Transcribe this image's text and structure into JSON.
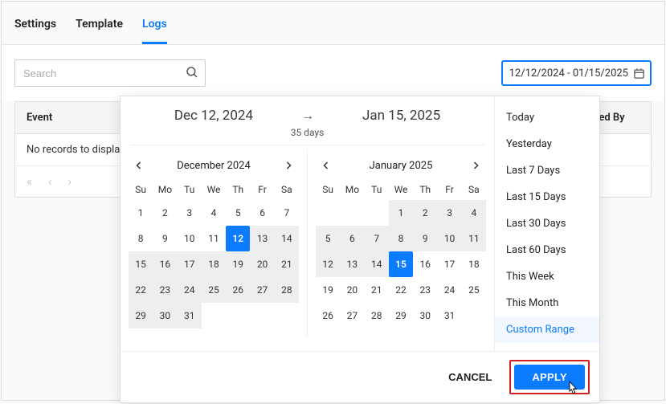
{
  "tabs": {
    "settings": "Settings",
    "template": "Template",
    "logs": "Logs",
    "active": "logs"
  },
  "search": {
    "placeholder": "Search"
  },
  "date_field": {
    "value": "12/12/2024 - 01/15/2025"
  },
  "table": {
    "columns": {
      "event": "Event",
      "by": "ated By"
    },
    "empty": "No records to displa",
    "pager": {
      "first": "«",
      "prev": "‹",
      "next": "›"
    }
  },
  "drp": {
    "start_label": "Dec 12, 2024",
    "end_label": "Jan 15, 2025",
    "duration": "35 days",
    "dow": [
      "Su",
      "Mo",
      "Tu",
      "We",
      "Th",
      "Fr",
      "Sa"
    ],
    "left": {
      "title": "December 2024",
      "first_dow": 0,
      "days_in_month": 31,
      "selected_day": 12,
      "range_start_day": 12,
      "range_ends_in_month": false
    },
    "right": {
      "title": "January 2025",
      "first_dow": 3,
      "days_in_month": 31,
      "selected_day": 15,
      "range_ends_in_month": true,
      "range_end_day": 15
    },
    "presets": [
      "Today",
      "Yesterday",
      "Last 7 Days",
      "Last 15 Days",
      "Last 30 Days",
      "Last 60 Days",
      "This Week",
      "This Month",
      "Custom Range"
    ],
    "preset_active_index": 8,
    "cancel": "CANCEL",
    "apply": "APPLY"
  }
}
